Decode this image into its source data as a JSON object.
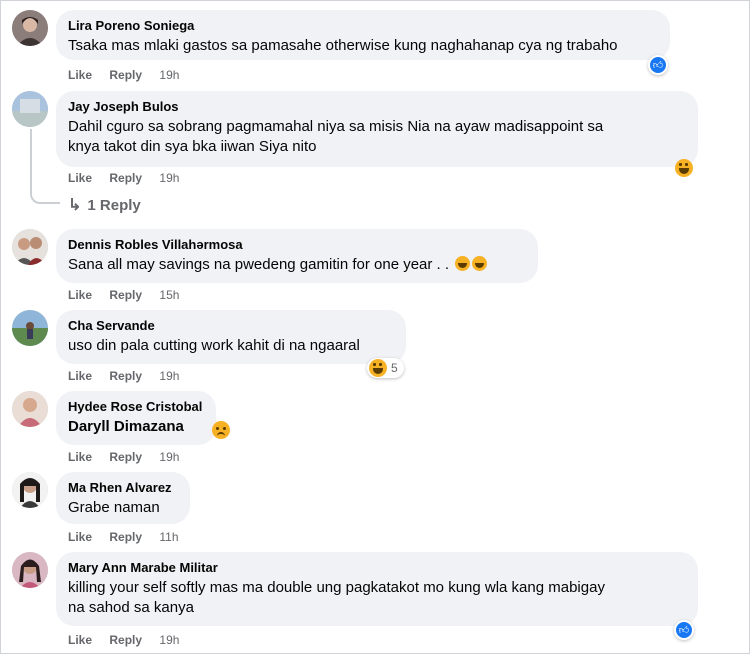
{
  "comments": [
    {
      "author": "Lira Poreno Soniega",
      "text": "Tsaka mas mlaki gastos sa pamasahe otherwise kung naghahanap cya ng trabaho",
      "like": "Like",
      "reply": "Reply",
      "time": "19h",
      "reaction": "like-icon"
    },
    {
      "author": "Jay Joseph Bulos",
      "text_line1": "Dahil cguro sa sobrang pagmamahal niya sa misis Nia na ayaw madisappoint sa",
      "text_line2": "knya takot din sya bka iiwan Siya nito",
      "like": "Like",
      "reply": "Reply",
      "time": "19h",
      "reaction": "haha-icon",
      "replies": "1 Reply"
    },
    {
      "author": "Dennis Robles Villahərmosa",
      "text": "Sana all may savings na pwedeng gamitin for one year . .",
      "like": "Like",
      "reply": "Reply",
      "time": "15h"
    },
    {
      "author": "Cha Servande",
      "text": "uso din pala cutting work kahit di na ngaaral",
      "like": "Like",
      "reply": "Reply",
      "time": "19h",
      "reaction": "haha-icon",
      "reaction_count": "5"
    },
    {
      "author": "Hydee Rose Cristobal",
      "text": "Daryll Dimazana",
      "like": "Like",
      "reply": "Reply",
      "time": "19h",
      "reaction": "sad-icon"
    },
    {
      "author": "Ma Rhen Alvarez",
      "text": "Grabe naman",
      "like": "Like",
      "reply": "Reply",
      "time": "11h"
    },
    {
      "author": "Mary Ann Marabe Militar",
      "text_line1": "killing your self softly mas ma double ung pagkatakot mo kung wla kang mabigay",
      "text_line2": "na sahod sa kanya",
      "like": "Like",
      "reply": "Reply",
      "time": "19h",
      "reaction": "like-icon"
    }
  ],
  "colors": {
    "bubble": "#f0f2f5",
    "meta": "#65676b",
    "like_blue": "#1877f2",
    "emoji_yellow": "#f7b125"
  }
}
